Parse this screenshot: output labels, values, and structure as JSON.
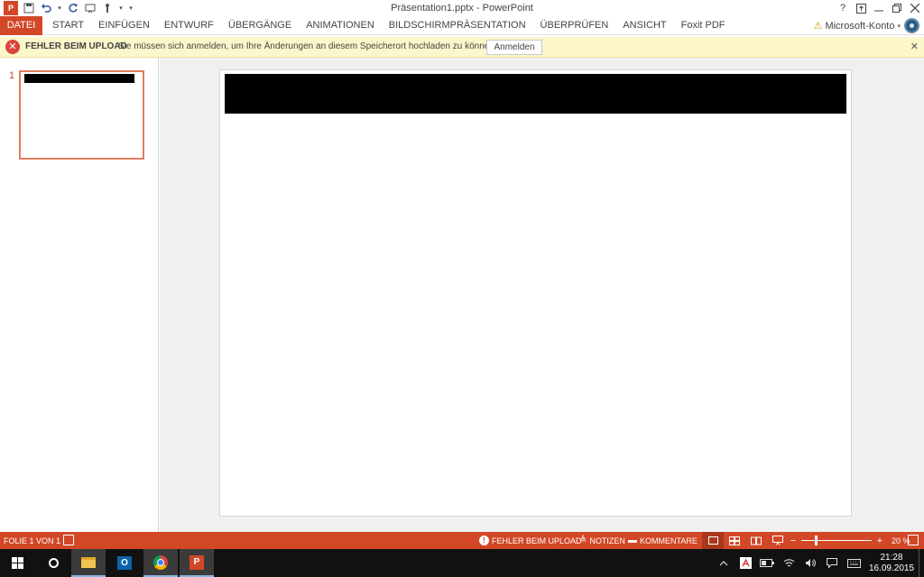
{
  "window": {
    "title": "Präsentation1.pptx - PowerPoint",
    "app_icon_label": "P",
    "help": "?",
    "accent": "#d24726"
  },
  "tabs": {
    "file": "DATEI",
    "items": [
      "START",
      "EINFÜGEN",
      "ENTWURF",
      "ÜBERGÄNGE",
      "ANIMATIONEN",
      "BILDSCHIRMPRÄSENTATION",
      "ÜBERPRÜFEN",
      "ANSICHT",
      "Foxit PDF"
    ]
  },
  "account": {
    "label": "Microsoft-Konto"
  },
  "message_bar": {
    "title": "FEHLER BEIM UPLOAD",
    "text": "Sie müssen sich anmelden, um Ihre Änderungen an diesem Speicherort hochladen zu können.",
    "button": "Anmelden",
    "background": "#fcf6cb"
  },
  "slides": {
    "thumbnail_number": "1"
  },
  "status_bar": {
    "slide_info": "FOLIE 1 VON 1",
    "upload_status": "FEHLER BEIM UPLOAD",
    "notes": "NOTIZEN",
    "comments": "KOMMENTARE",
    "zoom_percent": "20 %",
    "zoom_minus": "−",
    "zoom_plus": "+",
    "zoom_level": 0.2
  },
  "taskbar": {
    "outlook_label": "O",
    "powerpoint_label": "P",
    "time": "21:28",
    "date": "16.09.2015"
  }
}
